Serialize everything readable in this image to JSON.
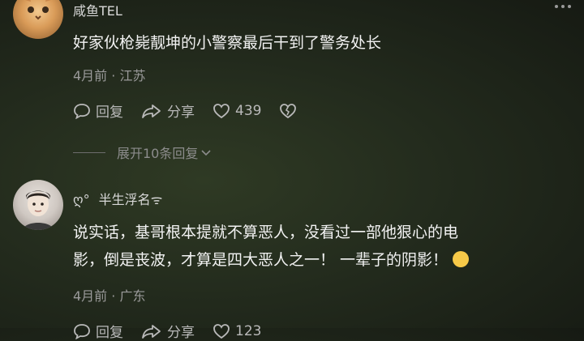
{
  "comments": [
    {
      "username": "咸鱼TEL",
      "text": "好家伙枪毙靓坤的小警察最后干到了警务处长",
      "meta": "4月前 · 江苏",
      "reply_label": "回复",
      "share_label": "分享",
      "likes": "439",
      "expand_label": "展开10条回复"
    },
    {
      "username_prefix": "ღ°",
      "username": "半生浮名",
      "username_suffix": "ᯤ",
      "text_line1": "说实话，基哥根本提就不算恶人，没看过一部他狠心的电",
      "text_line2": "影，倒是丧波，才算是四大恶人之一！ 一辈子的阴影！",
      "meta": "4月前 · 广东",
      "reply_label": "回复",
      "share_label": "分享",
      "likes": "123"
    }
  ],
  "colors": {
    "emoji": "#f7c948",
    "muted": "#9a9a9a"
  },
  "icons": [
    "reply-icon",
    "share-icon",
    "heart-icon",
    "dislike-icon",
    "chevron-down-icon",
    "more-icon",
    "laugh-cry-emoji"
  ]
}
